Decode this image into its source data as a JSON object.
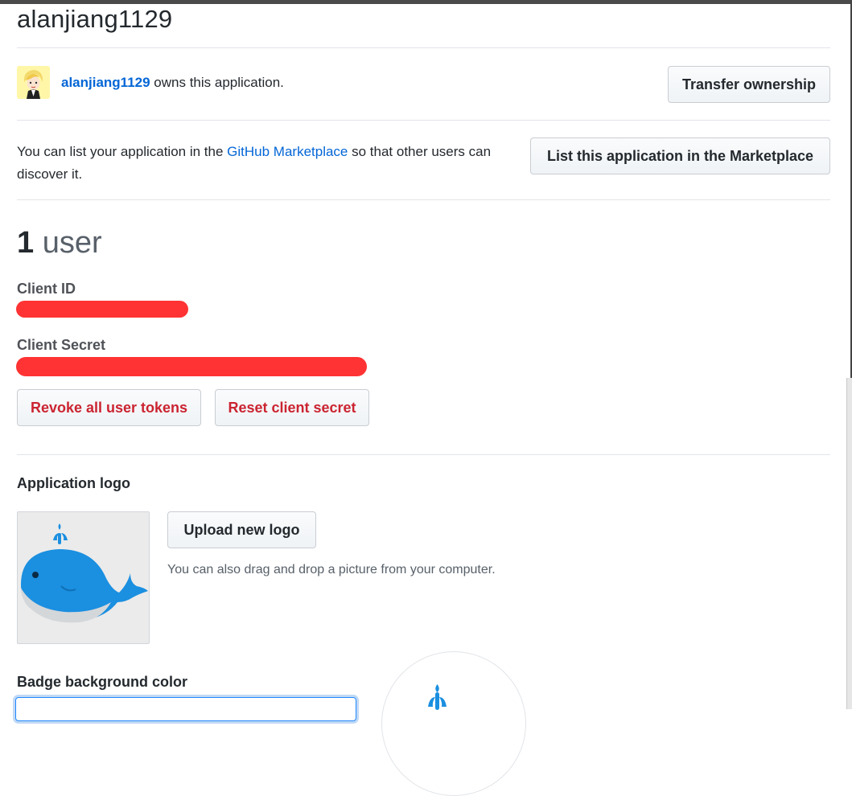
{
  "header": {
    "title": "alanjiang1129"
  },
  "owner": {
    "username": "alanjiang1129",
    "suffix": " owns this application.",
    "transfer_button": "Transfer ownership"
  },
  "marketplace": {
    "text_before": "You can list your application in the ",
    "link": "GitHub Marketplace",
    "text_after": " so that other users can discover it.",
    "button": "List this application in the Marketplace"
  },
  "users": {
    "count": "1",
    "label": "user"
  },
  "credentials": {
    "client_id_label": "Client ID",
    "client_secret_label": "Client Secret",
    "revoke_button": "Revoke all user tokens",
    "reset_button": "Reset client secret"
  },
  "logo": {
    "heading": "Application logo",
    "upload_button": "Upload new logo",
    "hint": "You can also drag and drop a picture from your computer."
  },
  "badge": {
    "heading": "Badge background color"
  },
  "colors": {
    "link": "#0366d6",
    "danger": "#cb2431",
    "whale_blue": "#1b8fe0",
    "redaction": "#ff3333"
  }
}
